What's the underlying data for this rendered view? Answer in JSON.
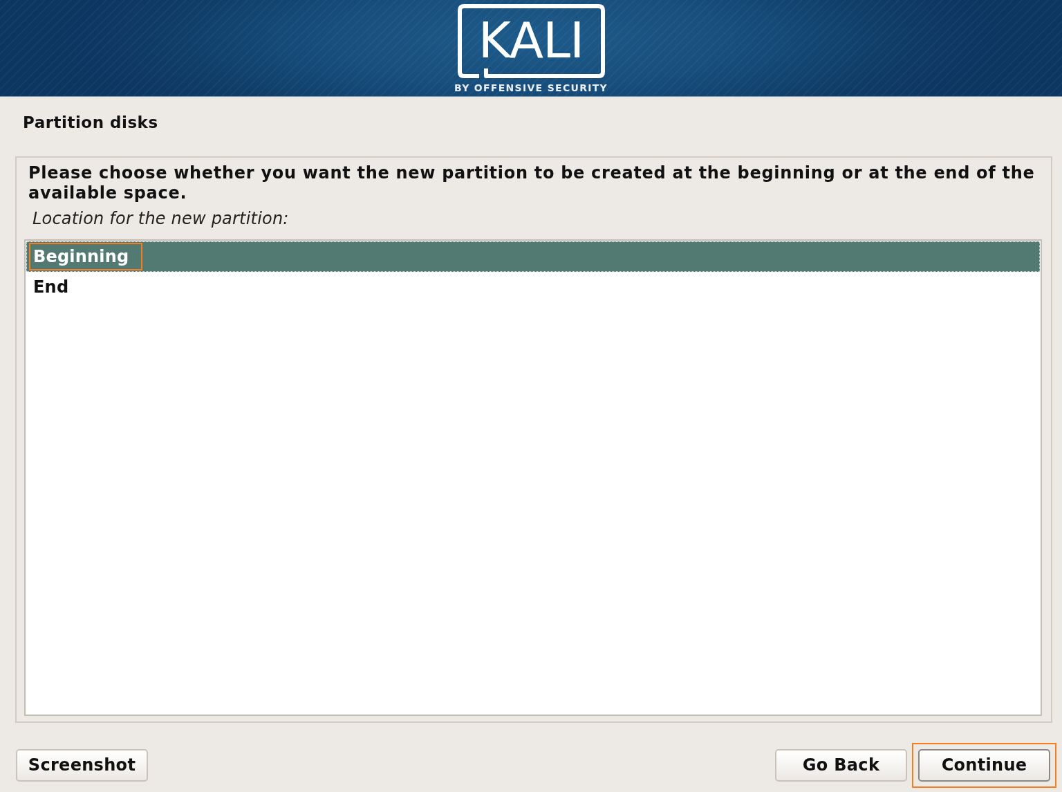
{
  "header": {
    "logo": {
      "wordmark": "KALI",
      "tagline": "BY OFFENSIVE SECURITY"
    }
  },
  "title": "Partition disks",
  "question": "Please choose whether you want the new partition to be created at the beginning or at the end of the available space.",
  "prompt": "Location for the new partition:",
  "options": [
    {
      "label": "Beginning",
      "selected": true,
      "highlighted": true
    },
    {
      "label": "End",
      "selected": false,
      "highlighted": false
    }
  ],
  "footer": {
    "left_buttons": [
      {
        "label": "Screenshot",
        "focused": false,
        "highlighted": false
      }
    ],
    "right_buttons": [
      {
        "label": "Go Back",
        "focused": false,
        "highlighted": false
      },
      {
        "label": "Continue",
        "focused": true,
        "highlighted": true
      }
    ]
  }
}
